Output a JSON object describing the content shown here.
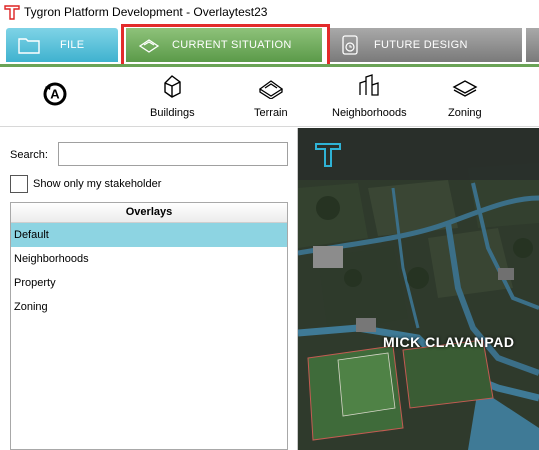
{
  "window": {
    "title": "Tygron Platform Development - Overlaytest23"
  },
  "tabs": [
    {
      "label": "FILE"
    },
    {
      "label": "CURRENT SITUATION"
    },
    {
      "label": "FUTURE DESIGN"
    }
  ],
  "toolbar": {
    "items": [
      {
        "label": "Buildings",
        "icon": "buildings-icon"
      },
      {
        "label": "Terrain",
        "icon": "terrain-icon"
      },
      {
        "label": "Neighborhoods",
        "icon": "neighborhoods-icon"
      },
      {
        "label": "Zoning",
        "icon": "zoning-icon"
      }
    ],
    "undo_icon": "undo-icon"
  },
  "left_panel": {
    "search": {
      "label": "Search:",
      "value": "",
      "placeholder": ""
    },
    "stakeholder_checkbox": {
      "label": "Show only my stakeholder",
      "checked": false
    },
    "overlays": {
      "header": "Overlays",
      "items": [
        "Default",
        "Neighborhoods",
        "Property",
        "Zoning"
      ],
      "selected": "Default"
    }
  },
  "map": {
    "label": "MICK CLAVANPAD"
  },
  "colors": {
    "file_tab": "#3fb2cf",
    "current_tab": "#5b9a49",
    "future_tab": "#7a7a7a",
    "highlight": "#e32b2b",
    "selected_row": "#8dd4e2"
  }
}
